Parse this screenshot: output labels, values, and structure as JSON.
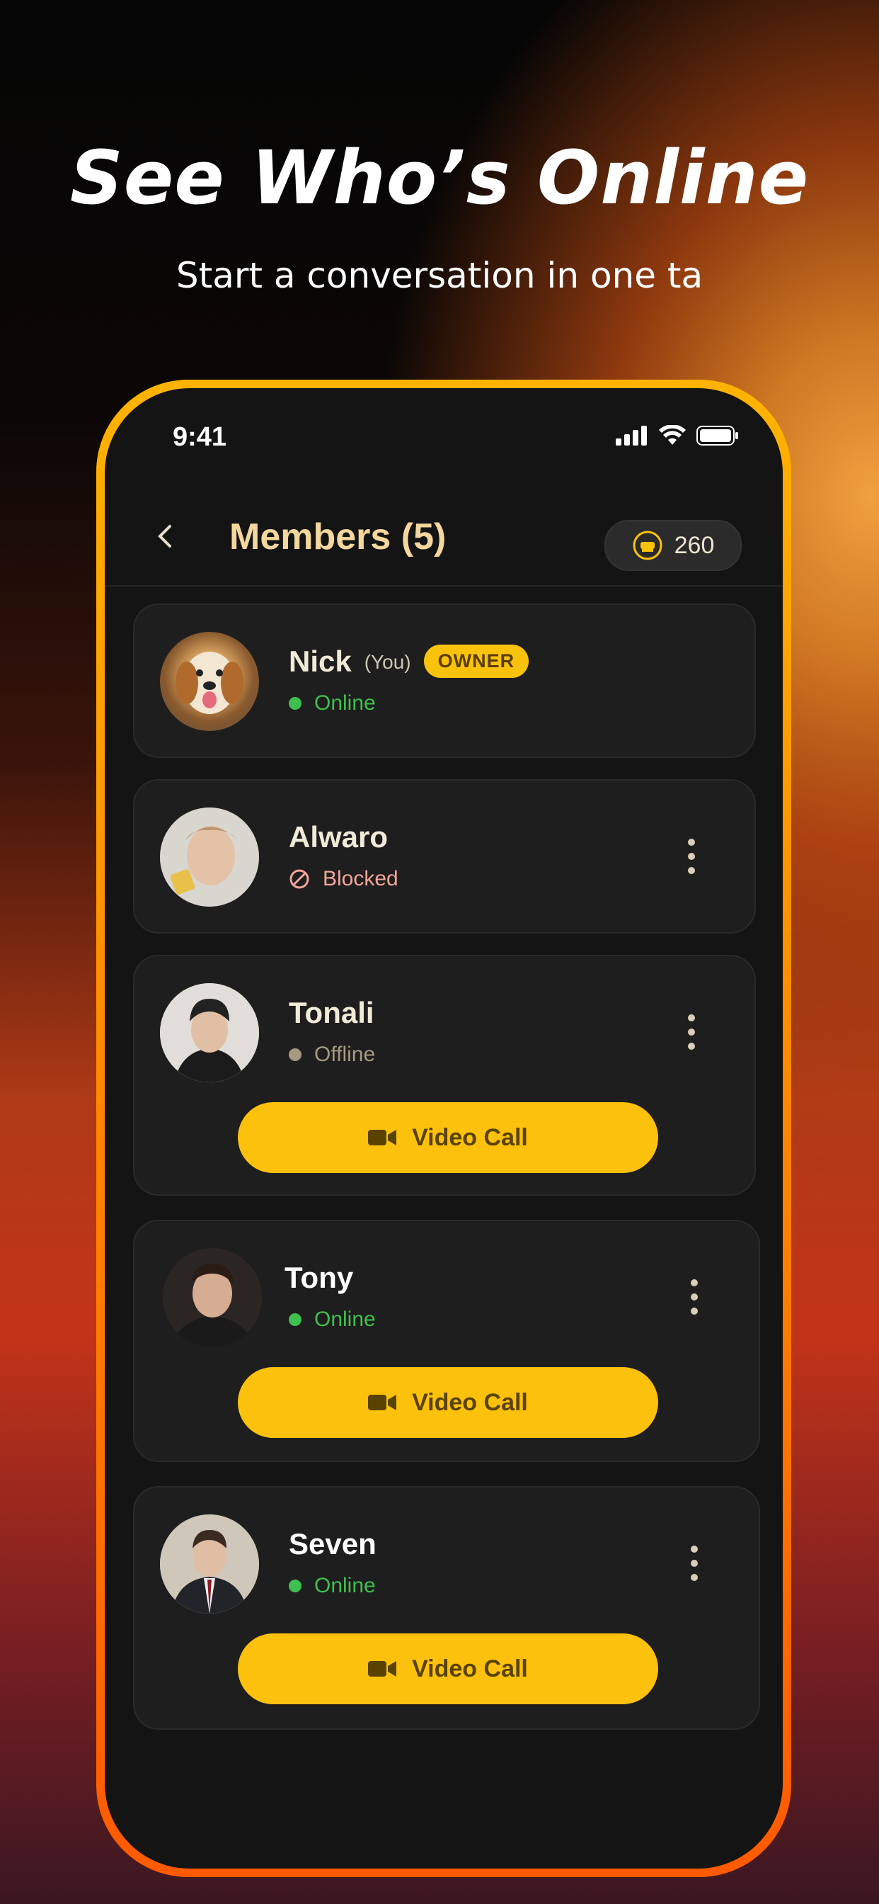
{
  "promo": {
    "headline": "See Who’s Online",
    "subline": "Start a conversation in one ta"
  },
  "status_bar": {
    "time": "9:41"
  },
  "header": {
    "back_icon": "chevron-left-icon",
    "title": "Members (5)",
    "coins": "260",
    "coin_icon": "sofa-coin-icon"
  },
  "members": [
    {
      "name": "Nick",
      "you_label": "(You)",
      "badge": "OWNER",
      "status": "Online",
      "status_color": "#3fbf4f"
    },
    {
      "name": "Alwaro",
      "status": "Blocked",
      "status_color": "#f2a59a"
    },
    {
      "name": "Tonali",
      "status": "Offline",
      "status_color": "#a59a82",
      "action": "Video Call"
    },
    {
      "name": "Tony",
      "status": "Online",
      "status_color": "#3fbf4f",
      "action": "Video Call"
    },
    {
      "name": "Seven",
      "status": "Online",
      "status_color": "#3fbf4f",
      "action": "Video Call"
    }
  ],
  "colors": {
    "accent": "#fcc10c",
    "background": "#141414",
    "card": "#1e1e1e"
  }
}
